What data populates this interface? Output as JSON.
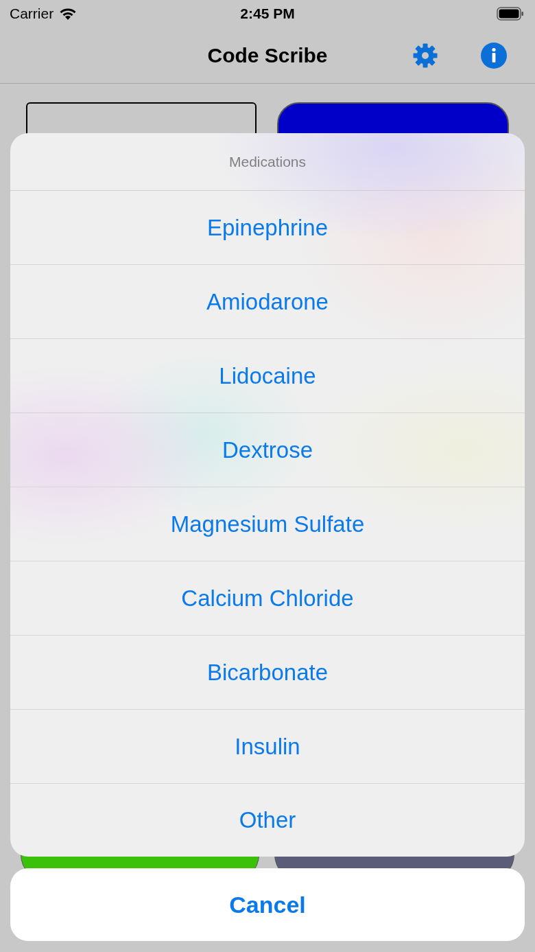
{
  "status_bar": {
    "carrier": "Carrier",
    "time": "2:45 PM"
  },
  "nav_bar": {
    "title": "Code Scribe"
  },
  "action_sheet": {
    "title": "Medications",
    "actions": [
      {
        "label": "Epinephrine"
      },
      {
        "label": "Amiodarone"
      },
      {
        "label": "Lidocaine"
      },
      {
        "label": "Dextrose"
      },
      {
        "label": "Magnesium Sulfate"
      },
      {
        "label": "Calcium Chloride"
      },
      {
        "label": "Bicarbonate"
      },
      {
        "label": "Insulin"
      },
      {
        "label": "Other"
      }
    ],
    "cancel": "Cancel"
  }
}
